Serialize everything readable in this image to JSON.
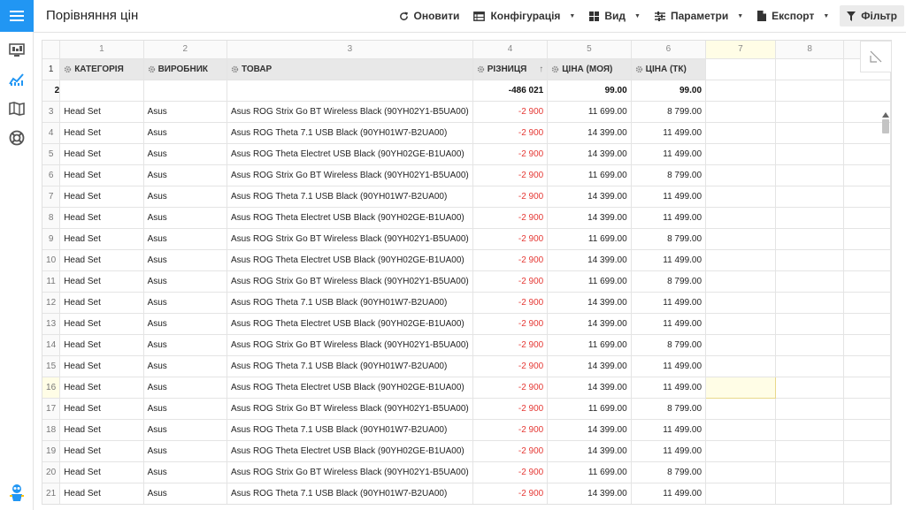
{
  "title": "Порівняння цін",
  "toolbar": {
    "refresh": "Оновити",
    "config": "Конфігурація",
    "view": "Вид",
    "params": "Параметри",
    "export": "Експорт",
    "filter": "Фільтр"
  },
  "colors": {
    "accent": "#2196f3",
    "negative": "#e53935",
    "selection": "#fffde6"
  },
  "sidebar": {
    "icons": [
      "monitor-chart-icon",
      "trend-chart-icon",
      "book-map-icon",
      "lifebuoy-icon"
    ],
    "logo": "mascot-logo-icon"
  },
  "columns": [
    "1",
    "2",
    "3",
    "4",
    "5",
    "6",
    "7",
    "8"
  ],
  "fields": {
    "category": "КАТЕГОРІЯ",
    "brand": "ВИРОБНИК",
    "product": "ТОВАР",
    "diff": "РІЗНИЦЯ",
    "my_price": "ЦІНА (МОЯ)",
    "tk_price": "ЦІНА (ТК)",
    "sort_indicator": "↑"
  },
  "totals": {
    "row": "2",
    "diff": "-486 021",
    "my_price": "99.00",
    "tk_price": "99.00"
  },
  "header_row_num": "1",
  "rows": [
    {
      "n": "3",
      "category": "Head Set",
      "brand": "Asus",
      "product": "Asus ROG Strix Go BT Wireless Black (90YH02Y1-B5UA00)",
      "diff": "-2 900",
      "my_price": "11 699.00",
      "tk_price": "8 799.00"
    },
    {
      "n": "4",
      "category": "Head Set",
      "brand": "Asus",
      "product": "Asus ROG Theta 7.1 USB Black (90YH01W7-B2UA00)",
      "diff": "-2 900",
      "my_price": "14 399.00",
      "tk_price": "11 499.00"
    },
    {
      "n": "5",
      "category": "Head Set",
      "brand": "Asus",
      "product": "Asus ROG Theta Electret USB Black (90YH02GE-B1UA00)",
      "diff": "-2 900",
      "my_price": "14 399.00",
      "tk_price": "11 499.00"
    },
    {
      "n": "6",
      "category": "Head Set",
      "brand": "Asus",
      "product": "Asus ROG Strix Go BT Wireless Black (90YH02Y1-B5UA00)",
      "diff": "-2 900",
      "my_price": "11 699.00",
      "tk_price": "8 799.00"
    },
    {
      "n": "7",
      "category": "Head Set",
      "brand": "Asus",
      "product": "Asus ROG Theta 7.1 USB Black (90YH01W7-B2UA00)",
      "diff": "-2 900",
      "my_price": "14 399.00",
      "tk_price": "11 499.00"
    },
    {
      "n": "8",
      "category": "Head Set",
      "brand": "Asus",
      "product": "Asus ROG Theta Electret USB Black (90YH02GE-B1UA00)",
      "diff": "-2 900",
      "my_price": "14 399.00",
      "tk_price": "11 499.00"
    },
    {
      "n": "9",
      "category": "Head Set",
      "brand": "Asus",
      "product": "Asus ROG Strix Go BT Wireless Black (90YH02Y1-B5UA00)",
      "diff": "-2 900",
      "my_price": "11 699.00",
      "tk_price": "8 799.00"
    },
    {
      "n": "10",
      "category": "Head Set",
      "brand": "Asus",
      "product": "Asus ROG Theta Electret USB Black (90YH02GE-B1UA00)",
      "diff": "-2 900",
      "my_price": "14 399.00",
      "tk_price": "11 499.00"
    },
    {
      "n": "11",
      "category": "Head Set",
      "brand": "Asus",
      "product": "Asus ROG Strix Go BT Wireless Black (90YH02Y1-B5UA00)",
      "diff": "-2 900",
      "my_price": "11 699.00",
      "tk_price": "8 799.00"
    },
    {
      "n": "12",
      "category": "Head Set",
      "brand": "Asus",
      "product": "Asus ROG Theta 7.1 USB Black (90YH01W7-B2UA00)",
      "diff": "-2 900",
      "my_price": "14 399.00",
      "tk_price": "11 499.00"
    },
    {
      "n": "13",
      "category": "Head Set",
      "brand": "Asus",
      "product": "Asus ROG Theta Electret USB Black (90YH02GE-B1UA00)",
      "diff": "-2 900",
      "my_price": "14 399.00",
      "tk_price": "11 499.00"
    },
    {
      "n": "14",
      "category": "Head Set",
      "brand": "Asus",
      "product": "Asus ROG Strix Go BT Wireless Black (90YH02Y1-B5UA00)",
      "diff": "-2 900",
      "my_price": "11 699.00",
      "tk_price": "8 799.00"
    },
    {
      "n": "15",
      "category": "Head Set",
      "brand": "Asus",
      "product": "Asus ROG Theta 7.1 USB Black (90YH01W7-B2UA00)",
      "diff": "-2 900",
      "my_price": "14 399.00",
      "tk_price": "11 499.00"
    },
    {
      "n": "16",
      "category": "Head Set",
      "brand": "Asus",
      "product": "Asus ROG Theta Electret USB Black (90YH02GE-B1UA00)",
      "diff": "-2 900",
      "my_price": "14 399.00",
      "tk_price": "11 499.00"
    },
    {
      "n": "17",
      "category": "Head Set",
      "brand": "Asus",
      "product": "Asus ROG Strix Go BT Wireless Black (90YH02Y1-B5UA00)",
      "diff": "-2 900",
      "my_price": "11 699.00",
      "tk_price": "8 799.00"
    },
    {
      "n": "18",
      "category": "Head Set",
      "brand": "Asus",
      "product": "Asus ROG Theta 7.1 USB Black (90YH01W7-B2UA00)",
      "diff": "-2 900",
      "my_price": "14 399.00",
      "tk_price": "11 499.00"
    },
    {
      "n": "19",
      "category": "Head Set",
      "brand": "Asus",
      "product": "Asus ROG Theta Electret USB Black (90YH02GE-B1UA00)",
      "diff": "-2 900",
      "my_price": "14 399.00",
      "tk_price": "11 499.00"
    },
    {
      "n": "20",
      "category": "Head Set",
      "brand": "Asus",
      "product": "Asus ROG Strix Go BT Wireless Black (90YH02Y1-B5UA00)",
      "diff": "-2 900",
      "my_price": "11 699.00",
      "tk_price": "8 799.00"
    },
    {
      "n": "21",
      "category": "Head Set",
      "brand": "Asus",
      "product": "Asus ROG Theta 7.1 USB Black (90YH01W7-B2UA00)",
      "diff": "-2 900",
      "my_price": "14 399.00",
      "tk_price": "11 499.00"
    }
  ],
  "selected": {
    "row": "16",
    "column": "7"
  }
}
